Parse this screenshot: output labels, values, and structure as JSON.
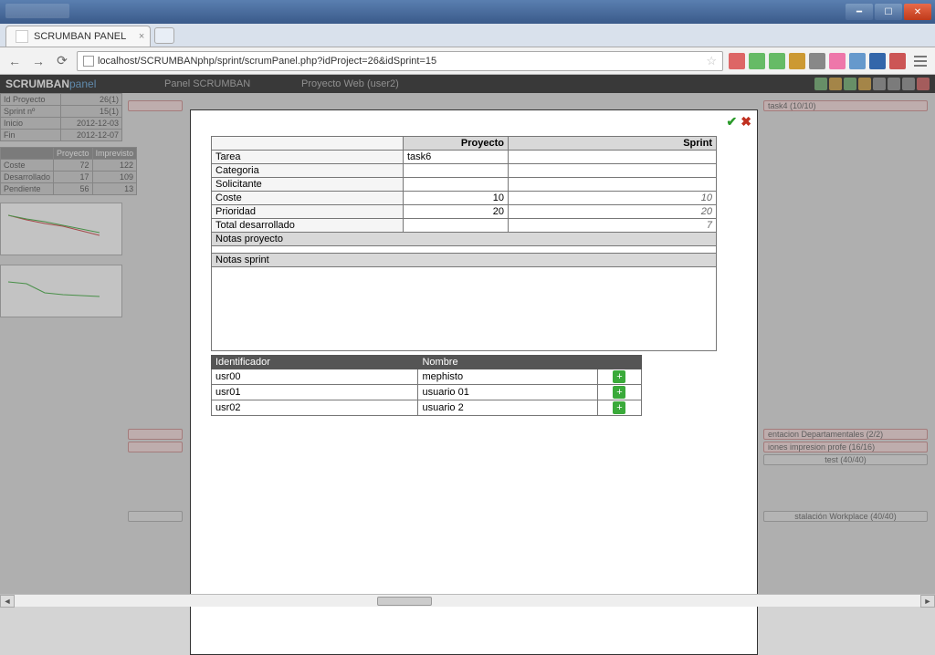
{
  "window": {
    "title": ""
  },
  "browser": {
    "tab_label": "SCRUMBAN PANEL",
    "url": "localhost/SCRUMBANphp/sprint/scrumPanel.php?idProject=26&idSprint=15",
    "ext_colors": [
      "#d66",
      "#6b6",
      "#6b6",
      "#c93",
      "#888",
      "#e7a",
      "#69c",
      "#36a",
      "#c55"
    ]
  },
  "bg": {
    "logo_a": "SCRUMBAN",
    "logo_b": "panel",
    "mid1": "Panel SCRUMBAN",
    "mid2": "Proyecto Web (user2)",
    "info_table": [
      [
        "Id Proyecto",
        "26(1)"
      ],
      [
        "Sprint nº",
        "15(1)"
      ],
      [
        "Inicio",
        "2012-12-03"
      ],
      [
        "Fin",
        "2012-12-07"
      ]
    ],
    "stats_header": [
      "",
      "Proyecto",
      "Imprevisto"
    ],
    "stats_rows": [
      [
        "Coste",
        "72",
        "122"
      ],
      [
        "Desarrollado",
        "17",
        "109"
      ],
      [
        "Pendiente",
        "56",
        "13"
      ]
    ],
    "cards_right": [
      "task4 (10/10)",
      "entacion Departamentales (2/2)",
      "iones impresion profe (16/16)",
      "test (40/40)",
      "stalación Workplace (40/40)"
    ]
  },
  "modal": {
    "headers": {
      "col1": "",
      "col2": "Proyecto",
      "col3": "Sprint"
    },
    "rows": {
      "tarea": {
        "label": "Tarea",
        "proyecto": "task6",
        "sprint": ""
      },
      "categoria": {
        "label": "Categoria",
        "proyecto": "",
        "sprint": ""
      },
      "solicitante": {
        "label": "Solicitante",
        "proyecto": "",
        "sprint": ""
      },
      "coste": {
        "label": "Coste",
        "proyecto": "10",
        "sprint": "10"
      },
      "prioridad": {
        "label": "Prioridad",
        "proyecto": "20",
        "sprint": "20"
      },
      "total": {
        "label": "Total desarrollado",
        "proyecto": "",
        "sprint": "7"
      },
      "notas_proyecto": {
        "label": "Notas proyecto"
      },
      "notas_sprint": {
        "label": "Notas sprint"
      }
    },
    "user_headers": {
      "id": "Identificador",
      "name": "Nombre"
    },
    "users": [
      {
        "id": "usr00",
        "name": "mephisto"
      },
      {
        "id": "usr01",
        "name": "usuario 01"
      },
      {
        "id": "usr02",
        "name": "usuario 2"
      }
    ]
  }
}
